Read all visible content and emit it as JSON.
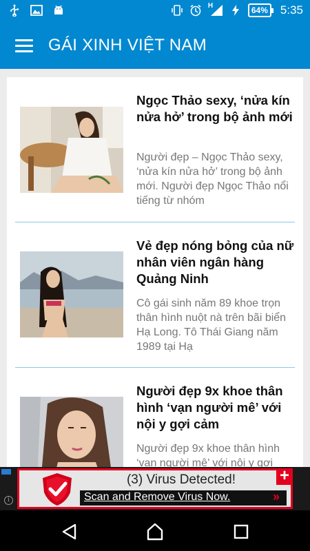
{
  "status_bar": {
    "icons_left": [
      "usb-icon",
      "image-icon",
      "android-icon"
    ],
    "icons_right": [
      "vibrate-icon",
      "alarm-icon",
      "signal-h-icon",
      "charging-icon"
    ],
    "network_label": "H",
    "battery": "64%",
    "time": "5:35"
  },
  "app_bar": {
    "title": "GÁI XINH VIỆT NAM",
    "menu_icon": "hamburger-menu-icon",
    "color": "#0288d1"
  },
  "articles": [
    {
      "title": "Ngọc Thảo sexy, ‘nửa kín nửa hở’ trong bộ ảnh mới",
      "excerpt": "Người đẹp – Ngọc Thảo sexy, ‘nửa kín nửa hở’ trong bộ ảnh mới. Người đẹp Ngọc Thảo nổi tiếng từ nhóm"
    },
    {
      "title": "Vẻ đẹp nóng bỏng của nữ nhân viên ngân hàng Quảng Ninh",
      "excerpt": "Cô gái sinh năm 89 khoe trọn thân hình nuột nà trên bãi biển Hạ Long. Tô Thái Giang năm 1989 tại Hạ"
    },
    {
      "title": "Người đẹp 9x khoe thân hình ‘vạn người mê’ với nội y gợi cảm",
      "excerpt": "Người đẹp 9x khoe thân hình ‘vạn người mê’ với nội y gợi"
    }
  ],
  "ad": {
    "headline": "(3) Virus Detected!",
    "cta": "Scan and Remove Virus Now.",
    "arrows": "»",
    "close": "+",
    "info": "i",
    "accent": "#e3001f"
  },
  "nav_bar": {
    "buttons": [
      "back-icon",
      "home-icon",
      "recents-icon"
    ]
  }
}
